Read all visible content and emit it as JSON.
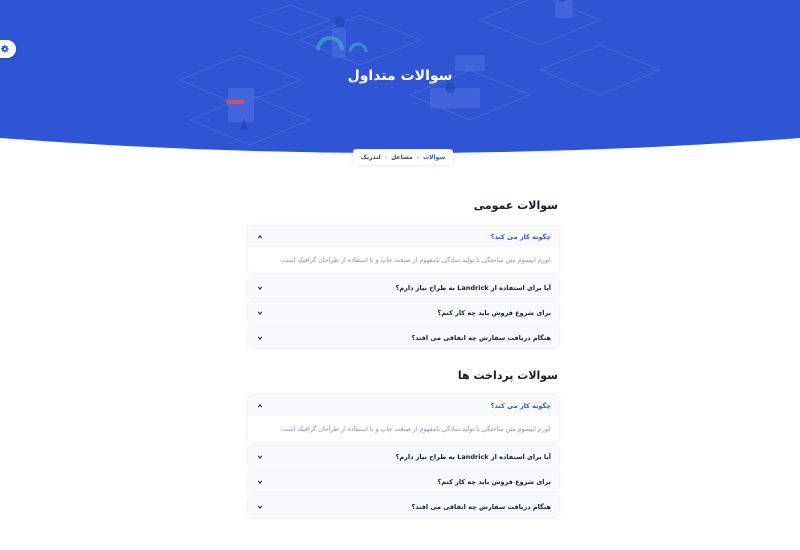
{
  "hero": {
    "title": "سوالات متداول"
  },
  "breadcrumb": {
    "items": [
      "لندریک",
      "مشاغل",
      "سوالات"
    ]
  },
  "colors": {
    "primary": "#2f55d4",
    "heading": "#161c2d",
    "muted": "#8492a6"
  },
  "sections": [
    {
      "title": "سوالات عمومی",
      "items": [
        {
          "question": "چگونه کار می کند؟",
          "answer": "لورم ایپسوم متن ساختگی با تولید سادگی نامفهوم از صنعت چاپ و با استفاده از طراحان گرافیک است.",
          "open": true
        },
        {
          "question": "آیا برای استفاده از Landrick به طراح نیاز دارم؟",
          "open": false
        },
        {
          "question": "برای شروع فروش باید چه کار کنم؟",
          "open": false
        },
        {
          "question": "هنگام دریافت سفارش چه اتفاقی می افتد؟",
          "open": false
        }
      ]
    },
    {
      "title": "سوالات پرداخت ها",
      "items": [
        {
          "question": "چگونه کار می کند؟",
          "answer": "لورم ایپسوم متن ساختگی با تولید سادگی نامفهوم از صنعت چاپ و با استفاده از طراحان گرافیک است.",
          "open": true
        },
        {
          "question": "آیا برای استفاده از Landrick به طراح نیاز دارم؟",
          "open": false
        },
        {
          "question": "برای شروع فروش باید چه کار کنم؟",
          "open": false
        },
        {
          "question": "هنگام دریافت سفارش چه اتفاقی می افتد؟",
          "open": false
        }
      ]
    }
  ],
  "icons": [
    "gear-icon",
    "chevron-left-icon",
    "chevron-up-icon",
    "chevron-down-icon"
  ]
}
